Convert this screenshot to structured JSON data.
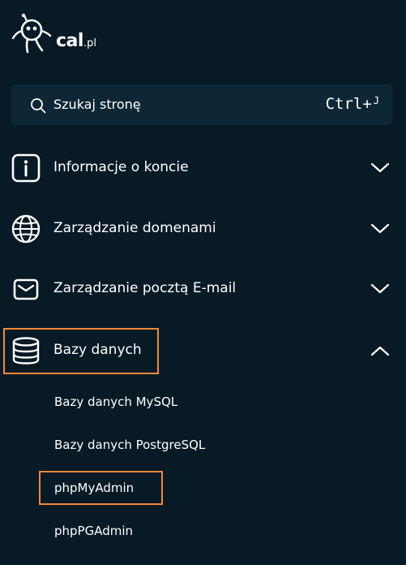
{
  "logo": {
    "brand": "cal",
    "tld": ".pl"
  },
  "search": {
    "label": "Szukaj stronę",
    "shortcut": "Ctrl+",
    "shortcut_key": "J"
  },
  "nav": {
    "items": [
      {
        "label": "Informacje o koncie",
        "icon": "info-icon",
        "expanded": false
      },
      {
        "label": "Zarządzanie domenami",
        "icon": "globe-icon",
        "expanded": false
      },
      {
        "label": "Zarządzanie pocztą E-mail",
        "icon": "mail-icon",
        "expanded": false
      },
      {
        "label": "Bazy danych",
        "icon": "database-icon",
        "expanded": true,
        "highlighted": true
      }
    ],
    "submenu": [
      {
        "label": "Bazy danych MySQL"
      },
      {
        "label": "Bazy danych PostgreSQL"
      },
      {
        "label": "phpMyAdmin",
        "highlighted": true
      },
      {
        "label": "phpPGAdmin"
      }
    ]
  },
  "colors": {
    "background": "#071a26",
    "search_background": "#0e2737",
    "highlight_border": "#f28a3b",
    "text": "#ffffff"
  }
}
